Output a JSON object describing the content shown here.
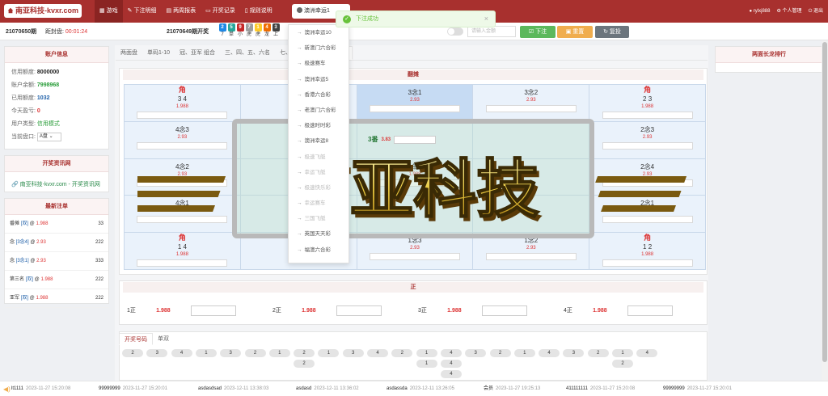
{
  "header": {
    "logo": "南亚科技-kvxr.com",
    "nav": [
      {
        "label": "游戏",
        "icon": "grid-icon",
        "active": true
      },
      {
        "label": "下注明细",
        "icon": "edit-icon"
      },
      {
        "label": "两周报表",
        "icon": "table-icon"
      },
      {
        "label": "开奖记录",
        "icon": "monitor-icon"
      },
      {
        "label": "规则说明",
        "icon": "book-icon"
      }
    ],
    "lottery_selected": "澳洲幸运1",
    "user": {
      "name": "rylxj888",
      "manage": "个人管理",
      "logout": "退出"
    }
  },
  "infobar": {
    "period": "21070650期",
    "countdown_label": "距封盘:",
    "countdown": "00:01:24",
    "last_period": "21070649期开奖",
    "result_balls": [
      {
        "n": "2",
        "c": "#1e88e5"
      },
      {
        "n": "5",
        "c": "#26a69a"
      },
      {
        "n": "9",
        "c": "#c62828"
      },
      {
        "n": "7",
        "c": "#9e9e9e"
      },
      {
        "n": "1",
        "c": "#ffca28"
      },
      {
        "n": "4",
        "c": "#ef6c00"
      },
      {
        "n": "3",
        "c": "#424242"
      }
    ],
    "result_subs": [
      "7",
      "单",
      "小",
      "虎",
      "虎",
      "龙",
      "上"
    ],
    "amount_placeholder": "请输入金额",
    "bet_button": "下注",
    "reset_button": "重置",
    "restore_button": "复投"
  },
  "account": {
    "title": "账户信息",
    "credit_label": "信用额度:",
    "credit": "8000000",
    "balance_label": "账户余额:",
    "balance": "7998968",
    "used_label": "已用额度:",
    "used": "1032",
    "profit_label": "今天盈亏:",
    "profit": "0",
    "type_label": "用户类型:",
    "type": "信用模式",
    "disk_label": "当前盘口:",
    "disk": "A盘"
  },
  "news": {
    "title": "开奖资讯网",
    "link": "南亚科技-kvxr.com - 开奖资讯网"
  },
  "recent": {
    "title": "最新注单",
    "rows": [
      {
        "name": "番摊",
        "code": "[双]",
        "odds": "1.988",
        "amt": "33"
      },
      {
        "name": "念",
        "code": "[3念4]",
        "odds": "2.93",
        "amt": "222"
      },
      {
        "name": "念",
        "code": "[3念1]",
        "odds": "2.93",
        "amt": "333"
      },
      {
        "name": "第三名",
        "code": "[双]",
        "odds": "1.988",
        "amt": "222"
      },
      {
        "name": "亚军",
        "code": "[双]",
        "odds": "1.988",
        "amt": "222"
      }
    ]
  },
  "right_panel": {
    "title": "两面长龙排行"
  },
  "tabs": [
    "两面盘",
    "单码1-10",
    "冠、亚军 组合",
    "三、四、五、六名",
    "七、八、九、十名",
    "番摊"
  ],
  "grid": {
    "title": "翻摊",
    "cells": [
      {
        "corner": "角",
        "name": "3 4",
        "odds": "1.988"
      },
      {
        "name": "",
        "odds": ""
      },
      {
        "name": "3念1",
        "odds": "2.93",
        "hl": true
      },
      {
        "name": "3念2",
        "odds": "2.93"
      },
      {
        "corner": "角",
        "name": "2 3",
        "odds": "1.988"
      },
      {
        "name": "4念3",
        "odds": "2.93"
      },
      {
        "name": "",
        "odds": ""
      },
      {
        "name": "",
        "odds": ""
      },
      {
        "name": "",
        "odds": ""
      },
      {
        "name": "2念3",
        "odds": "2.93"
      },
      {
        "name": "4念2",
        "odds": "2.93"
      },
      {
        "name": "",
        "odds": ""
      },
      {
        "name": "单",
        "odds": "1.988"
      },
      {
        "name": "",
        "odds": ""
      },
      {
        "name": "2念4",
        "odds": "2.93"
      },
      {
        "name": "4念1",
        "odds": "2.93"
      },
      {
        "name": "",
        "odds": ""
      },
      {
        "name": "",
        "odds": ""
      },
      {
        "name": "",
        "odds": ""
      },
      {
        "name": "2念1",
        "odds": "2.93"
      },
      {
        "corner": "角",
        "name": "1 4",
        "odds": "1.988"
      },
      {
        "name": "",
        "odds": ""
      },
      {
        "name": "1念3",
        "odds": "2.93"
      },
      {
        "name": "1念2",
        "odds": "2.93"
      },
      {
        "corner": "角",
        "name": "1 2",
        "odds": "1.988"
      }
    ],
    "center": {
      "name": "3番",
      "odds": "3.83"
    }
  },
  "zheng": {
    "title": "正",
    "items": [
      {
        "label": "1正",
        "odds": "1.988"
      },
      {
        "label": "2正",
        "odds": "1.988"
      },
      {
        "label": "3正",
        "odds": "1.988"
      },
      {
        "label": "4正",
        "odds": "1.988"
      }
    ]
  },
  "results": {
    "tabs": [
      "开奖号码",
      "单双"
    ],
    "row1": [
      "2",
      "3",
      "4",
      "1",
      "3",
      "2",
      "1",
      "2",
      "1",
      "3",
      "4",
      "2",
      "1",
      "4",
      "3",
      "2",
      "1",
      "4",
      "3",
      "2",
      "1",
      "4"
    ],
    "row2": [
      {
        "col": 7,
        "v": "2"
      },
      {
        "col": 12,
        "v": "1"
      },
      {
        "col": 13,
        "v": "4"
      },
      {
        "col": 20,
        "v": "2"
      }
    ],
    "row3": [
      {
        "col": 13,
        "v": "4"
      }
    ]
  },
  "dropdown": {
    "items": [
      "澳洲幸运10",
      "新澳门六合彩",
      "极速赛车",
      "澳洲幸运5",
      "香港六合彩",
      "老澳门六合彩",
      "极速时时彩",
      "澳洲幸运8",
      "极速飞艇",
      "幸运飞艇",
      "极速快乐彩",
      "幸运赛车",
      "三国飞艇",
      "英国天天彩",
      "福澳六合彩"
    ]
  },
  "toast": {
    "message": "下注成功"
  },
  "watermark": "南亚科技",
  "ticker": [
    {
      "user": "lt1111",
      "time": "2023-11-27 15:20:08"
    },
    {
      "user": "99999999",
      "time": "2023-11-27 15:20:01"
    },
    {
      "user": "asdasdsad",
      "time": "2023-12-11 13:38:03"
    },
    {
      "user": "asdasd",
      "time": "2023-12-11 13:36:02"
    },
    {
      "user": "asdassda",
      "time": "2023-12-11 13:26:05"
    },
    {
      "user": "会员",
      "time": "2023-11-27 19:25:13"
    },
    {
      "user": "411111111",
      "time": "2023-11-27 15:20:08"
    },
    {
      "user": "99999999",
      "time": "2023-11-27 15:20:01"
    }
  ]
}
